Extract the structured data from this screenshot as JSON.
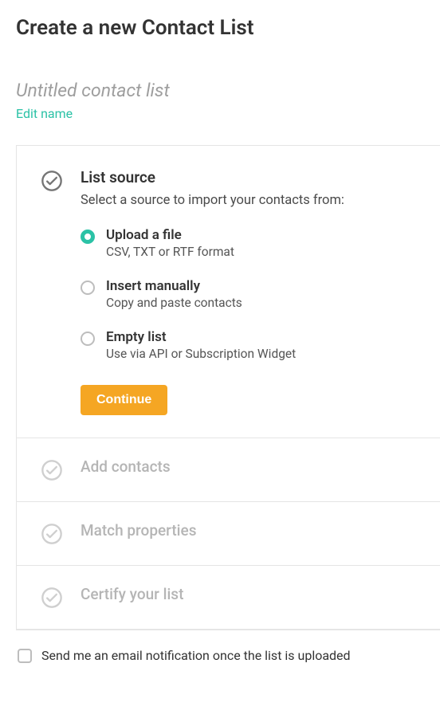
{
  "page_title": "Create a new Contact List",
  "list_name": "Untitled contact list",
  "edit_name_label": "Edit name",
  "steps": {
    "list_source": {
      "title": "List source",
      "subtitle": "Select a source to import your contacts from:",
      "options": {
        "upload": {
          "label": "Upload a file",
          "desc": "CSV, TXT or RTF format"
        },
        "manual": {
          "label": "Insert manually",
          "desc": "Copy and paste contacts"
        },
        "empty": {
          "label": "Empty list",
          "desc": "Use via API or Subscription Widget"
        }
      },
      "continue_label": "Continue"
    },
    "add_contacts": {
      "title": "Add contacts"
    },
    "match_properties": {
      "title": "Match properties"
    },
    "certify": {
      "title": "Certify your list"
    }
  },
  "notify_label": "Send me an email notification once the list is uploaded"
}
